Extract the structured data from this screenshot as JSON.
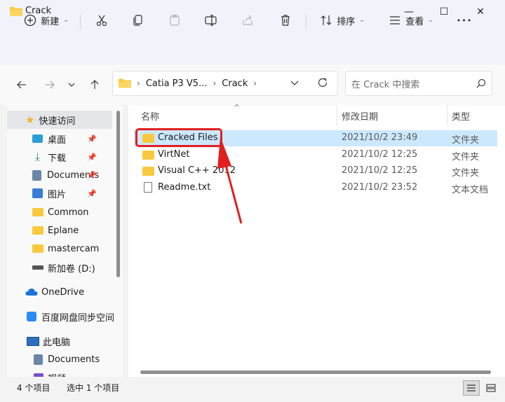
{
  "window": {
    "title": "Crack",
    "minimize_glyph": "—",
    "maximize_glyph": "☐",
    "close_glyph": "✕"
  },
  "toolbar": {
    "new_label": "新建",
    "sort_label": "排序",
    "view_label": "查看",
    "more_glyph": "•••"
  },
  "address": {
    "crumbs": [
      "Catia P3 V5...",
      "Crack"
    ]
  },
  "search": {
    "placeholder": "在 Crack 中搜索"
  },
  "sidebar": {
    "items": [
      {
        "label": "快速访问",
        "icon": "star-icon"
      },
      {
        "label": "桌面",
        "icon": "desktop-icon",
        "pinned": true
      },
      {
        "label": "下载",
        "icon": "download-icon",
        "pinned": true
      },
      {
        "label": "Documents",
        "icon": "document-icon",
        "pinned": true
      },
      {
        "label": "图片",
        "icon": "picture-icon",
        "pinned": true
      },
      {
        "label": "Common",
        "icon": "folder-icon"
      },
      {
        "label": "Eplane",
        "icon": "folder-icon"
      },
      {
        "label": "mastercam",
        "icon": "folder-icon"
      },
      {
        "label": "新加卷 (D:)",
        "icon": "drive-icon"
      },
      {
        "label": "OneDrive",
        "icon": "cloud-icon"
      },
      {
        "label": "百度网盘同步空间",
        "icon": "baidu-icon"
      },
      {
        "label": "此电脑",
        "icon": "computer-icon"
      },
      {
        "label": "Documents",
        "icon": "document-icon"
      },
      {
        "label": "视频",
        "icon": "video-icon"
      }
    ]
  },
  "columns": {
    "name": "名称",
    "modified": "修改日期",
    "type": "类型"
  },
  "files": [
    {
      "name": "Cracked Files",
      "modified": "2021/10/2 23:49",
      "type": "文件夹",
      "icon": "folder-icon",
      "selected": true
    },
    {
      "name": "VirtNet",
      "modified": "2021/10/2 12:25",
      "type": "文件夹",
      "icon": "folder-icon"
    },
    {
      "name": "Visual C++ 2012",
      "modified": "2021/10/2 12:25",
      "type": "文件夹",
      "icon": "folder-icon"
    },
    {
      "name": "Readme.txt",
      "modified": "2021/10/2 23:52",
      "type": "文本文档",
      "icon": "text-file-icon"
    }
  ],
  "status": {
    "count": "4 个项目",
    "selected": "选中 1 个项目"
  },
  "colors": {
    "selection": "#cce8ff",
    "highlight": "#e02020",
    "folder": "#f8c93e"
  }
}
